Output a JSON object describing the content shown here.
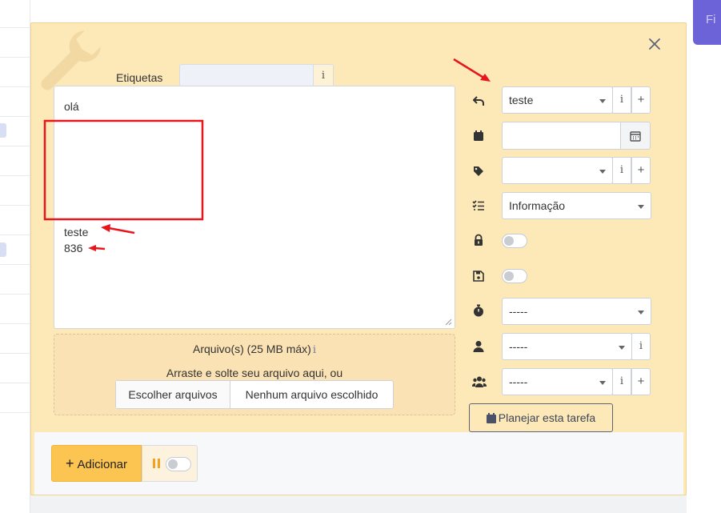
{
  "corner_button": {
    "label": "Fi"
  },
  "tags": {
    "label": "Etiquetas",
    "value": "",
    "info": "i"
  },
  "editor": {
    "lines": [
      "olá",
      "teste",
      "836"
    ]
  },
  "upload": {
    "title": "Arquivo(s) (25 MB máx)",
    "info": "i",
    "hint": "Arraste e solte seu arquivo aqui, ou",
    "choose_label": "Escolher arquivos",
    "no_file_label": "Nenhum arquivo escolhido"
  },
  "fields": {
    "reply": {
      "value": "teste",
      "info": "i",
      "add": "+"
    },
    "date": {
      "value": ""
    },
    "tag": {
      "value": "",
      "info": "i",
      "add": "+"
    },
    "type": {
      "value": "Informação"
    },
    "timer": {
      "value": "-----"
    },
    "user": {
      "value": "-----",
      "info": "i"
    },
    "group": {
      "value": "-----",
      "info": "i",
      "add": "+"
    }
  },
  "toggles": {
    "lock": false,
    "save": false,
    "pause": false
  },
  "plan_button": {
    "label": "Planejar esta tarefa"
  },
  "add_button": {
    "plus": "+",
    "label": "Adicionar"
  },
  "colors": {
    "modal_bg": "#fde8b8",
    "accent": "#fcc451",
    "annotation": "#e8151b",
    "corner_button": "#6c63d9"
  },
  "icons": [
    "wrench-icon",
    "close-icon",
    "reply-icon",
    "calendar-icon",
    "tag-icon",
    "checklist-icon",
    "lock-icon",
    "save-icon",
    "stopwatch-icon",
    "user-icon",
    "users-icon",
    "calendar-icon",
    "pause-icon"
  ]
}
